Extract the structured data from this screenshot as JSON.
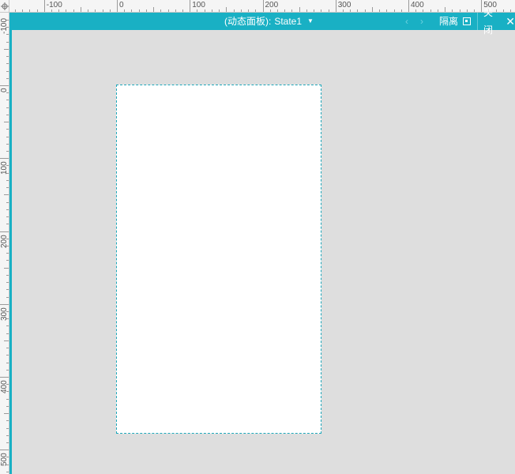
{
  "ruler": {
    "horizontal_labels": [
      "-100",
      "0",
      "100",
      "200",
      "300",
      "400",
      "500"
    ],
    "vertical_labels": [
      "-100",
      "0",
      "100",
      "200",
      "300",
      "400",
      "500"
    ]
  },
  "header": {
    "title": "(动态面板):",
    "state": "State1",
    "prev_glyph": "‹",
    "next_glyph": "›",
    "isolate_label": "隔离",
    "close_label": "关闭",
    "close_glyph": "✕"
  },
  "colors": {
    "accent": "#19b0c4",
    "canvas_bg": "#dedede",
    "artboard": "#ffffff"
  },
  "icons": [
    "crosshair-icon",
    "caret-down-icon",
    "chevron-left-icon",
    "chevron-right-icon",
    "isolate-icon",
    "close-icon"
  ]
}
